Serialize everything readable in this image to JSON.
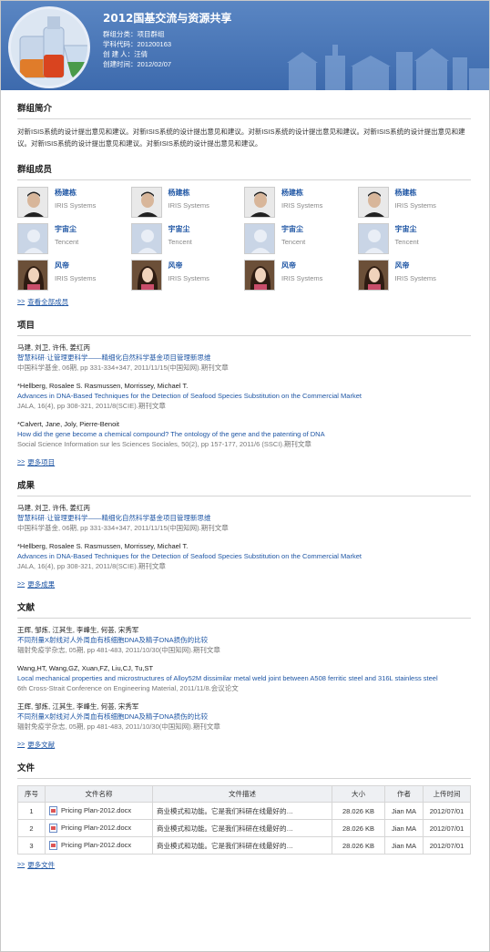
{
  "header": {
    "title": "2012国基交流与资源共享",
    "category": "群组分类：项目群组",
    "code": "学科代码：201200163",
    "creator": "创 建 人：汪倩",
    "created": "创建时间：2012/02/07"
  },
  "intro": {
    "heading": "群组简介",
    "text": "对新ISIS系统的设计提出意见和建议。对新ISIS系统的设计提出意见和建议。对新ISIS系统的设计提出意见和建议。对新ISIS系统的设计提出意见和建议。对新ISIS系统的设计提出意见和建议。对新ISIS系统的设计提出意见和建议。"
  },
  "members": {
    "heading": "群组成员",
    "more": "查看全部成员",
    "items": [
      {
        "name": "杨建栋",
        "org": "IRIS Systems",
        "photo": "man"
      },
      {
        "name": "杨建栋",
        "org": "IRIS Systems",
        "photo": "man"
      },
      {
        "name": "杨建栋",
        "org": "IRIS Systems",
        "photo": "man"
      },
      {
        "name": "杨建栋",
        "org": "IRIS Systems",
        "photo": "man"
      },
      {
        "name": "宇宙尘",
        "org": "Tencent",
        "photo": "placeholder"
      },
      {
        "name": "宇宙尘",
        "org": "Tencent",
        "photo": "placeholder"
      },
      {
        "name": "宇宙尘",
        "org": "Tencent",
        "photo": "placeholder"
      },
      {
        "name": "宇宙尘",
        "org": "Tencent",
        "photo": "placeholder"
      },
      {
        "name": "风帝",
        "org": "IRIS Systems",
        "photo": "woman"
      },
      {
        "name": "风帝",
        "org": "IRIS Systems",
        "photo": "woman"
      },
      {
        "name": "风帝",
        "org": "IRIS Systems",
        "photo": "woman"
      },
      {
        "name": "风帝",
        "org": "IRIS Systems",
        "photo": "woman"
      }
    ]
  },
  "projects": {
    "heading": "项目",
    "more": "更多项目",
    "items": [
      {
        "authors": "马建, 刘卫, 许伟, 姜红丙",
        "title": "智慧科研·让管理更科学——精细化自然科学基金项目管理新思维",
        "source": "中国科学基金, 06期, pp 331-334+347, 2011/11/15(中国知网).期刊文章"
      },
      {
        "authors": "*Hellberg, Rosalee S. Rasmussen, Morrissey, Michael T.",
        "title": "Advances in DNA-Based Techniques for the Detection of Seafood Species Substitution on the Commercial Market",
        "source": "JALA, 16(4), pp 308-321, 2011/8(SCIE).期刊文章"
      },
      {
        "authors": "*Calvert, Jane, Joly, Pierre-Benoit",
        "title": "How did the gene become a chemical compound? The ontology of the gene and the patenting of DNA",
        "source": "Social Science Information sur les Sciences Sociales, 50(2), pp 157-177, 2011/6 (SSCI).期刊文章"
      }
    ]
  },
  "results": {
    "heading": "成果",
    "more": "更多成果",
    "items": [
      {
        "authors": "马建, 刘卫, 许伟, 姜红丙",
        "title": "智慧科研·让管理更科学——精细化自然科学基金项目管理新思维",
        "source": "中国科学基金, 06期, pp 331-334+347, 2011/11/15(中国知网).期刊文章"
      },
      {
        "authors": "*Hellberg, Rosalee S. Rasmussen, Morrissey, Michael T.",
        "title": "Advances in DNA-Based Techniques for the Detection of Seafood Species Substitution on the Commercial Market",
        "source": "JALA, 16(4), pp 308-321, 2011/8(SCIE).期刊文章"
      }
    ]
  },
  "literature": {
    "heading": "文献",
    "more": "更多文献",
    "items": [
      {
        "authors": "王辉, 邹炼, 江其生, 李峰生, 何荟, 宋秀军",
        "title": "不同剂量X射线对人外周血有核细胞DNA及精子DNA损伤的比较",
        "source": "辐射免疫学杂志, 05期, pp 481-483, 2011/10/30(中国知网).期刊文章"
      },
      {
        "authors": "Wang,HT, Wang,GZ, Xuan,FZ, Liu,CJ, Tu,ST",
        "title": "Local mechanical properties and microstructures of Alloy52M dissimilar metal weld joint between A508 ferritic steel and 316L stainless steel",
        "source": "6th Cross-Strait Conference on Engineering Material, 2011/11/8.会议论文"
      },
      {
        "authors": "王辉, 邹炼, 江其生, 李峰生, 何荟, 宋秀军",
        "title": "不同剂量X射线对人外周血有核细胞DNA及精子DNA损伤的比较",
        "source": "辐射免疫学杂志, 05期, pp 481-483, 2011/10/30(中国知网).期刊文章"
      }
    ]
  },
  "files": {
    "heading": "文件",
    "more": "更多文件",
    "columns": [
      "序号",
      "文件名称",
      "文件描述",
      "大小",
      "作者",
      "上传时间"
    ],
    "rows": [
      {
        "no": "1",
        "name": "Pricing Plan-2012.docx",
        "desc": "商业模式和功能。它是我们科研在线最好的…",
        "size": "28.026 KB",
        "author": "Jian MA",
        "date": "2012/07/01"
      },
      {
        "no": "2",
        "name": "Pricing Plan-2012.docx",
        "desc": "商业模式和功能。它是我们科研在线最好的…",
        "size": "28.026 KB",
        "author": "Jian MA",
        "date": "2012/07/01"
      },
      {
        "no": "3",
        "name": "Pricing Plan-2012.docx",
        "desc": "商业模式和功能。它是我们科研在线最好的…",
        "size": "28.026 KB",
        "author": "Jian MA",
        "date": "2012/07/01"
      }
    ]
  }
}
